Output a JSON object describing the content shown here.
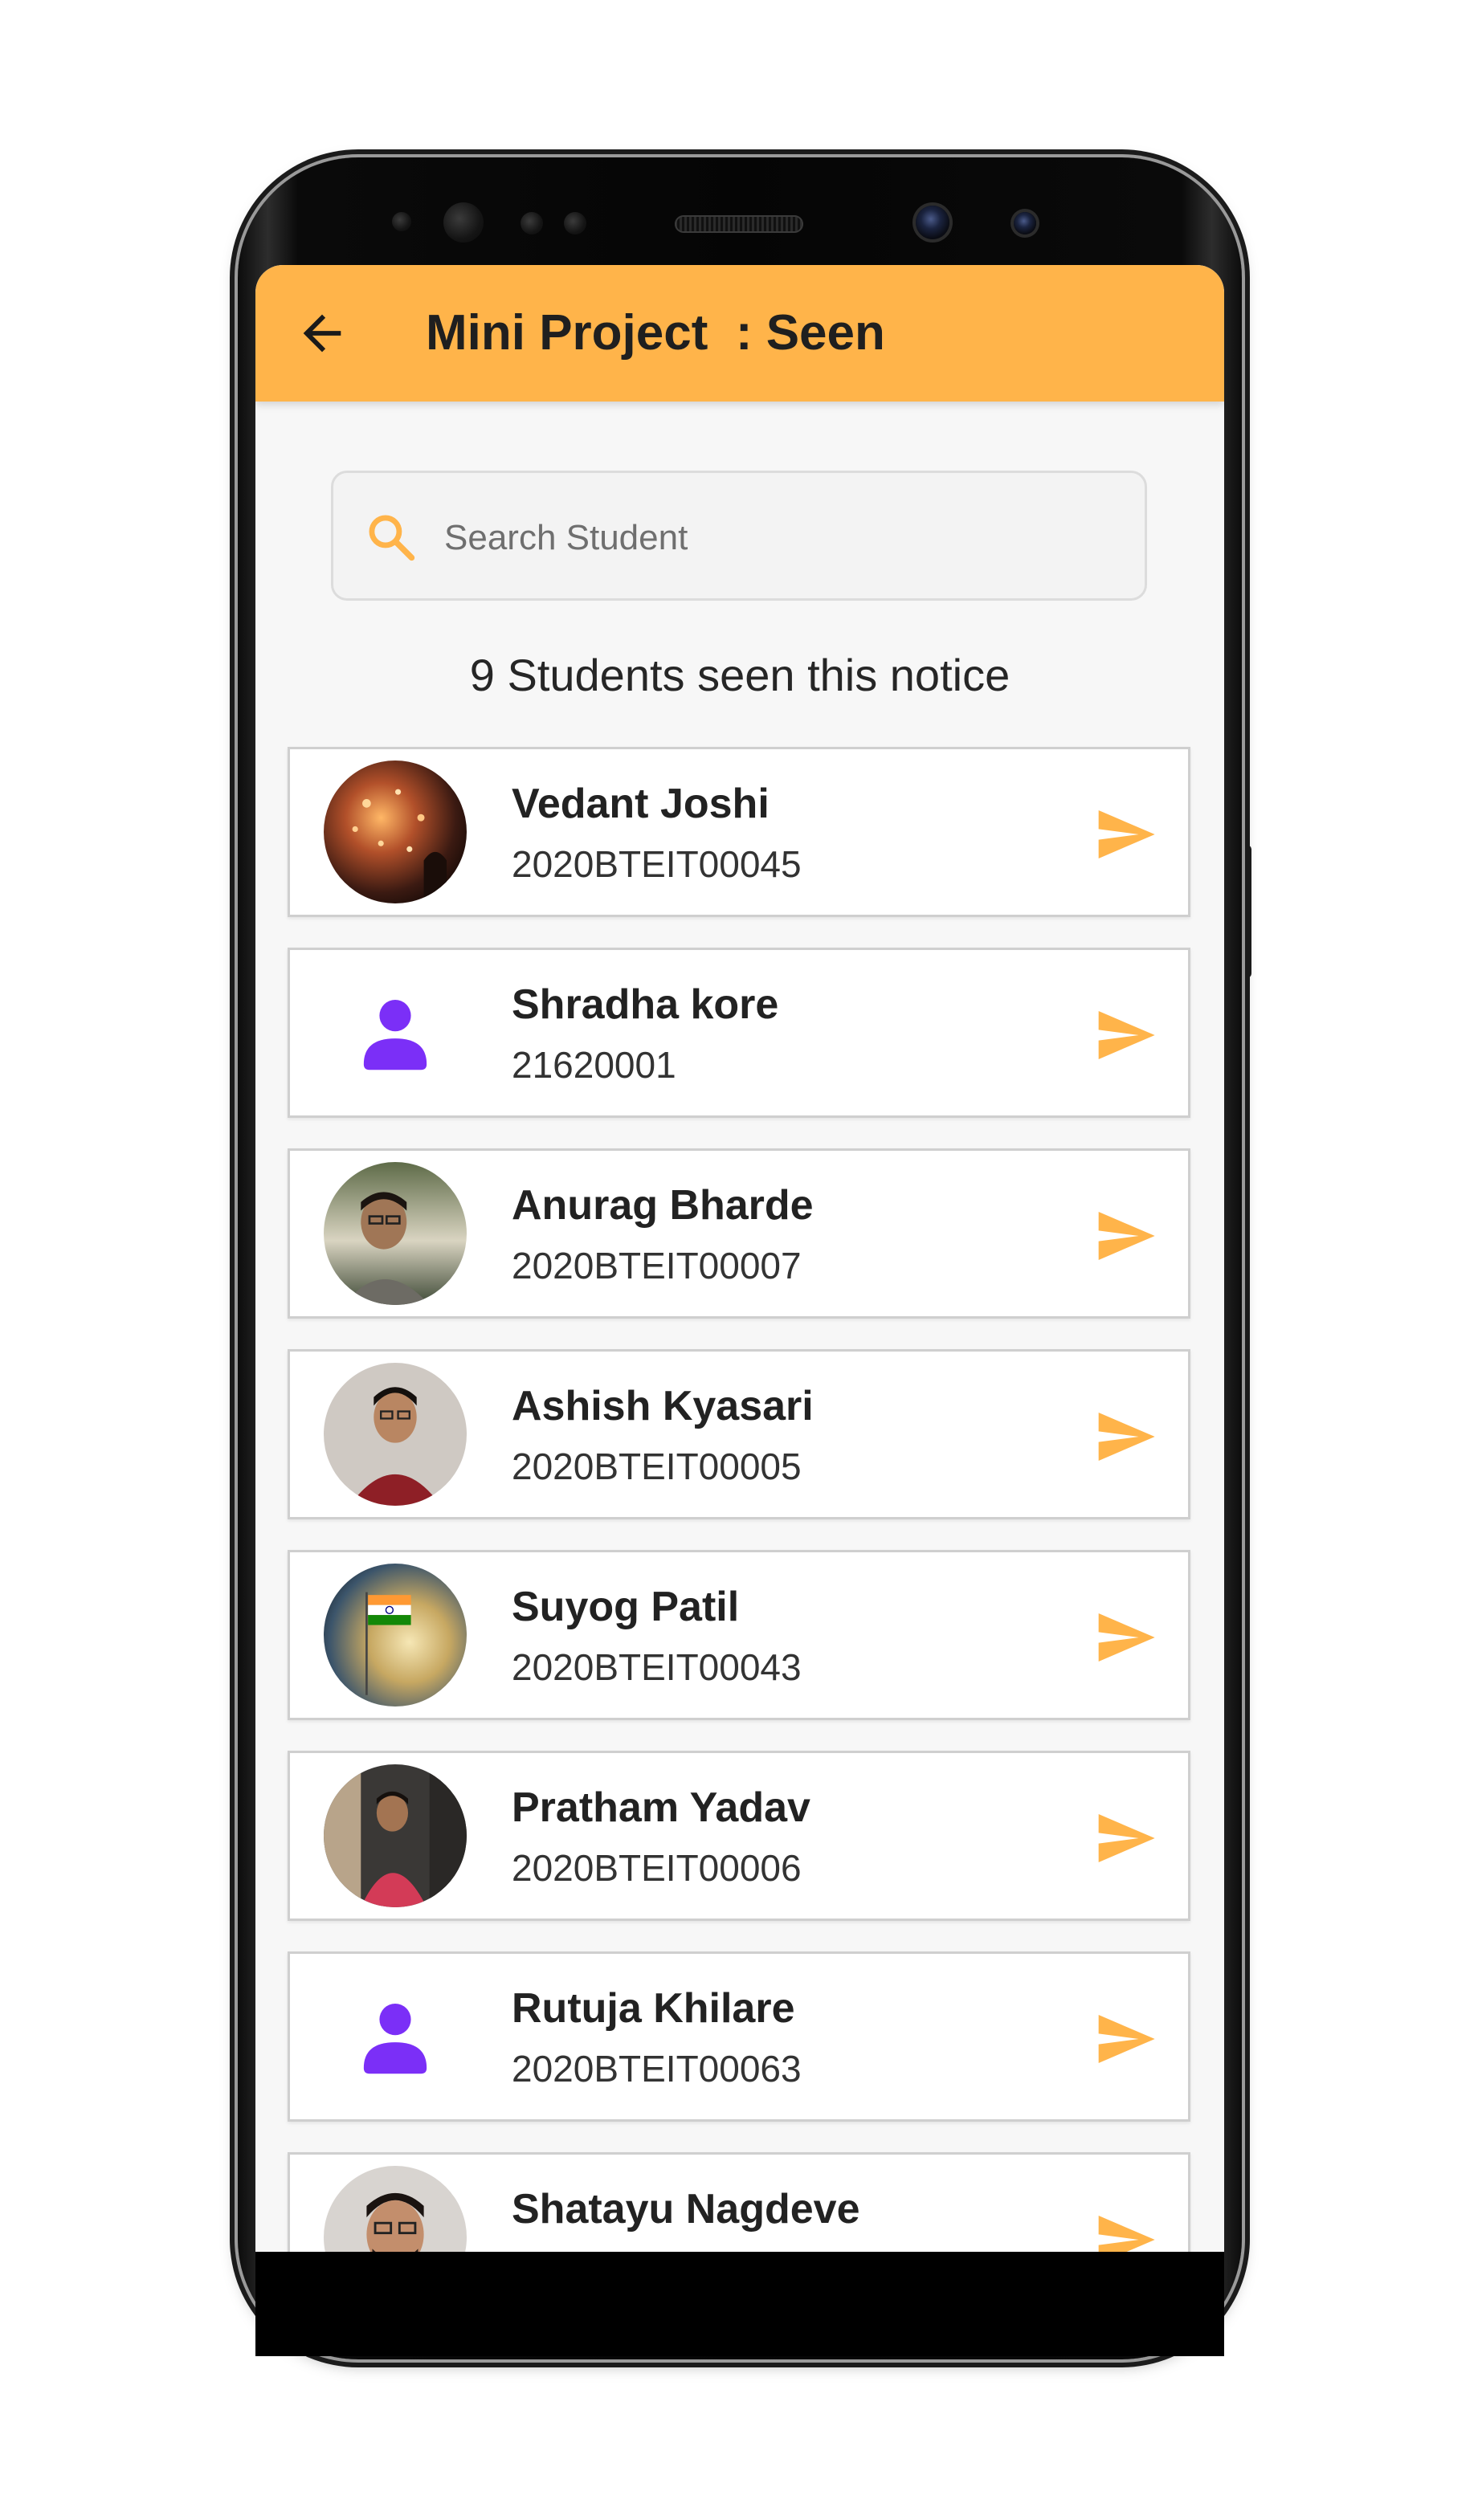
{
  "app_bar": {
    "title": "Mini Project  : Seen",
    "back_icon": "arrow-left-icon"
  },
  "search": {
    "placeholder": "Search Student",
    "value": "",
    "icon": "search-icon"
  },
  "seen_count_text": "9 Students seen this notice",
  "students": [
    {
      "name": "Vedant Joshi",
      "id": "2020BTEIT00045",
      "avatar": "photo"
    },
    {
      "name": "Shradha kore",
      "id": "21620001",
      "avatar": "default-person-icon"
    },
    {
      "name": "Anurag Bharde",
      "id": "2020BTEIT00007",
      "avatar": "photo"
    },
    {
      "name": "Ashish Kyasari",
      "id": "2020BTEIT00005",
      "avatar": "photo"
    },
    {
      "name": "Suyog Patil",
      "id": "2020BTEIT00043",
      "avatar": "photo"
    },
    {
      "name": "Pratham Yadav",
      "id": "2020BTEIT00006",
      "avatar": "photo"
    },
    {
      "name": "Rutuja Khilare",
      "id": "2020BTEIT00063",
      "avatar": "default-person-icon"
    },
    {
      "name": "Shatayu Nagdeve",
      "id": "",
      "avatar": "photo"
    }
  ],
  "colors": {
    "accent": "#ffb44a",
    "send_icon": "#ffb44a",
    "person_icon": "#7b2ff7",
    "background": "#f7f7f7"
  }
}
